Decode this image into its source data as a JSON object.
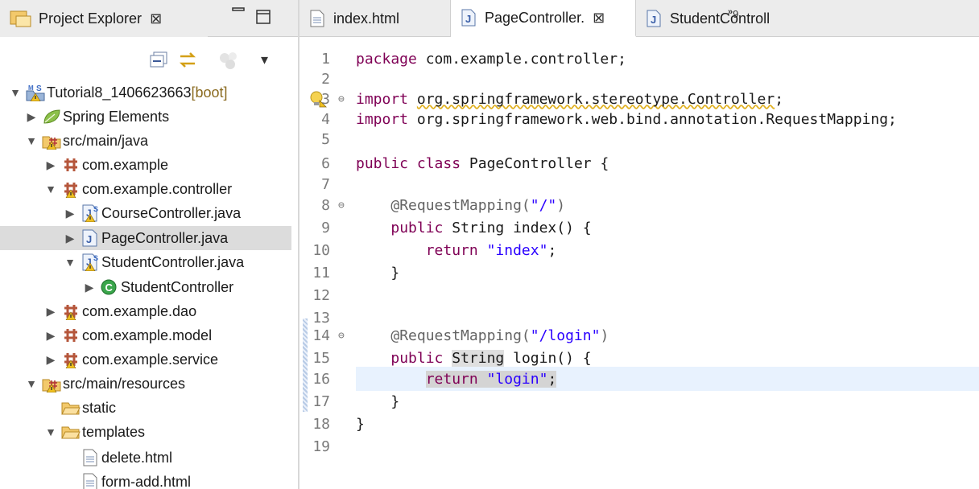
{
  "explorer": {
    "tab_label": "Project Explorer",
    "close_glyph": "⊠",
    "minimize_glyph": "▭",
    "maximize_glyph": "□",
    "toolbar": {
      "collapse_icon": "collapse-all-icon",
      "link_icon": "link-with-editor-icon",
      "filter_icon": "filters-icon",
      "menu_glyph": "▾"
    },
    "tree": [
      {
        "label": "Tutorial8_1406623663",
        "suffix": " [boot]",
        "twisty": "▼",
        "icon": "spring-project-icon"
      },
      {
        "label": "Spring Elements",
        "twisty": "▶",
        "icon": "spring-leaf-icon"
      },
      {
        "label": "src/main/java",
        "twisty": "▼",
        "icon": "source-folder-icon"
      },
      {
        "label": "com.example",
        "twisty": "▶",
        "icon": "package-icon"
      },
      {
        "label": "com.example.controller",
        "twisty": "▼",
        "icon": "package-warning-icon"
      },
      {
        "label": "CourseController.java",
        "twisty": "▶",
        "icon": "java-file-warning-icon"
      },
      {
        "label": "PageController.java",
        "twisty": "▶",
        "icon": "java-file-icon"
      },
      {
        "label": "StudentController.java",
        "twisty": "▼",
        "icon": "java-file-warning-icon"
      },
      {
        "label": "StudentController",
        "twisty": "▶",
        "icon": "class-icon"
      },
      {
        "label": "com.example.dao",
        "twisty": "▶",
        "icon": "package-warning-icon"
      },
      {
        "label": "com.example.model",
        "twisty": "▶",
        "icon": "package-icon"
      },
      {
        "label": "com.example.service",
        "twisty": "▶",
        "icon": "package-warning-icon"
      },
      {
        "label": "src/main/resources",
        "twisty": "▼",
        "icon": "source-folder-icon"
      },
      {
        "label": "static",
        "twisty": "",
        "icon": "folder-icon"
      },
      {
        "label": "templates",
        "twisty": "▼",
        "icon": "folder-icon"
      },
      {
        "label": "delete.html",
        "twisty": "",
        "icon": "html-file-icon"
      },
      {
        "label": "form-add.html",
        "twisty": "",
        "icon": "html-file-icon"
      }
    ]
  },
  "editor": {
    "tabs": [
      {
        "label": "index.html",
        "icon": "html-file-icon"
      },
      {
        "label": "PageController.",
        "icon": "java-file-icon",
        "close_glyph": "⊠"
      },
      {
        "label": "StudentControll",
        "icon": "java-file-icon"
      }
    ],
    "overflow_label": "»",
    "overflow_count": "9",
    "line_numbers": [
      "1",
      "2",
      "3",
      "4",
      "5",
      "6",
      "7",
      "8",
      "9",
      "10",
      "11",
      "12",
      "13",
      "14",
      "15",
      "16",
      "17",
      "18",
      "19"
    ],
    "fold_glyph": "⊖",
    "colors": {
      "keyword": "#7f0055",
      "string": "#2a00ff",
      "annotation": "#646464",
      "current_line": "#e8f2fe",
      "selected_row": "#dcdcdc"
    },
    "code": {
      "l1_kw": "package",
      "l1_rest": " com.example.controller;",
      "l3_kw": "import",
      "l3_sp": " ",
      "l3_pkg": "org.springframework.stereotype.Controller",
      "l3_end": ";",
      "l4_kw": "import",
      "l4_rest": " org.springframework.web.bind.annotation.RequestMapping;",
      "l6_kw1": "public",
      "l6_kw2": "class",
      "l6_rest": " PageController {",
      "l8_ann": "@RequestMapping(",
      "l8_str": "\"/\"",
      "l8_end": ")",
      "l9_kw": "public",
      "l9_rest": " String index() {",
      "l10_kw": "return",
      "l10_str": "\"index\"",
      "l10_end": ";",
      "l11": "}",
      "l14_ann": "@RequestMapping(",
      "l14_str": "\"/login\"",
      "l14_end": ")",
      "l15_kw": "public",
      "l15_word": "String",
      "l15_rest": " login() {",
      "l16_kw": "return",
      "l16_str": "\"login\"",
      "l16_end": ";",
      "l17": "}",
      "l18": "}"
    }
  }
}
